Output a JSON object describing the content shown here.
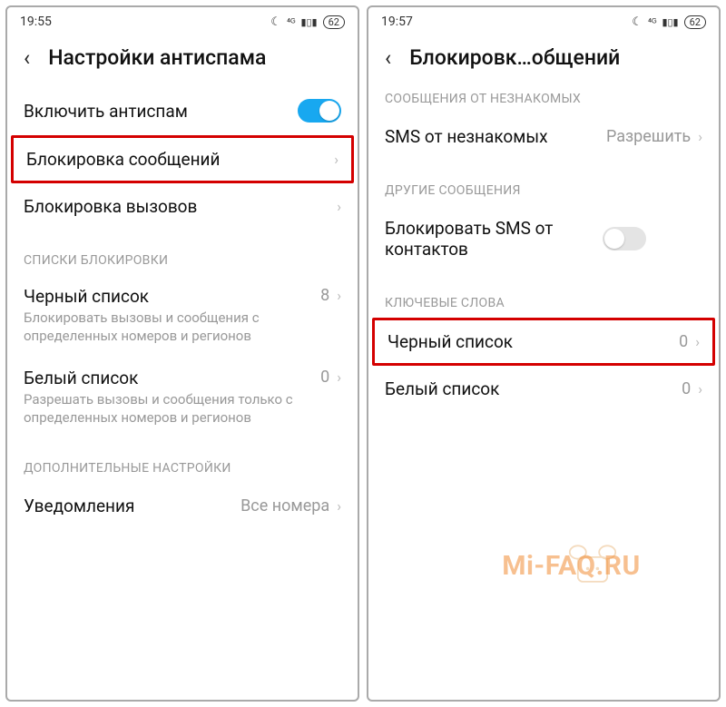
{
  "watermark": "Mi-FAQ.RU",
  "left": {
    "status": {
      "time": "19:55",
      "battery": "62"
    },
    "title": "Настройки антиспама",
    "enable_antispam": "Включить антиспам",
    "block_messages": "Блокировка сообщений",
    "block_calls": "Блокировка вызовов",
    "section_blocklists": "СПИСКИ БЛОКИРОВКИ",
    "blacklist": {
      "title": "Черный список",
      "sub": "Блокировать вызовы и сообщения с определенных номеров и регионов",
      "count": "8"
    },
    "whitelist": {
      "title": "Белый список",
      "sub": "Разрешать вызовы и сообщения только с определенных номеров и регионов",
      "count": "0"
    },
    "section_additional": "ДОПОЛНИТЕЛЬНЫЕ НАСТРОЙКИ",
    "notifications": {
      "title": "Уведомления",
      "value": "Все номера"
    }
  },
  "right": {
    "status": {
      "time": "19:57",
      "battery": "62"
    },
    "title": "Блокировк…общений",
    "section_unknown": "СООБЩЕНИЯ ОТ НЕЗНАКОМЫХ",
    "sms_unknown": {
      "title": "SMS от незнакомых",
      "value": "Разрешить"
    },
    "section_other": "ДРУГИЕ СООБЩЕНИЯ",
    "block_sms_contacts": "Блокировать SMS от контактов",
    "section_keywords": "КЛЮЧЕВЫЕ СЛОВА",
    "blacklist": {
      "title": "Черный список",
      "count": "0"
    },
    "whitelist": {
      "title": "Белый список",
      "count": "0"
    }
  }
}
